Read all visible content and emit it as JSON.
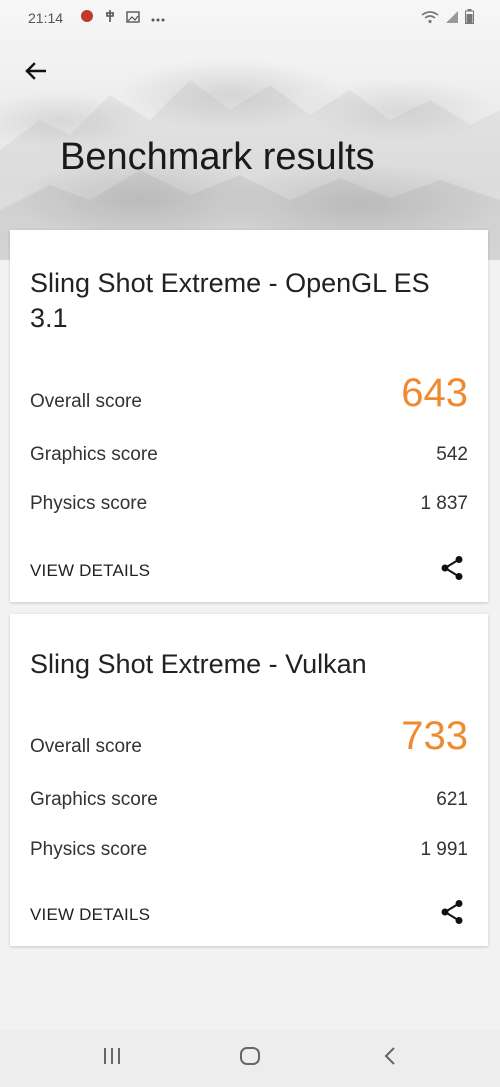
{
  "status_bar": {
    "time": "21:14",
    "left_icons": [
      "notification-dot-icon",
      "usb-icon",
      "image-icon",
      "more-icon"
    ],
    "right_icons": [
      "wifi-icon",
      "signal-icon",
      "battery-icon"
    ]
  },
  "header": {
    "title": "Benchmark results",
    "back_icon": "back-arrow-icon"
  },
  "results": [
    {
      "title": "Sling Shot Extreme - OpenGL ES 3.1",
      "overall_label": "Overall score",
      "overall_value": "643",
      "graphics_label": "Graphics score",
      "graphics_value": "542",
      "physics_label": "Physics score",
      "physics_value": "1 837",
      "details_label": "VIEW DETAILS",
      "share_icon": "share-icon"
    },
    {
      "title": "Sling Shot Extreme - Vulkan",
      "overall_label": "Overall score",
      "overall_value": "733",
      "graphics_label": "Graphics score",
      "graphics_value": "621",
      "physics_label": "Physics score",
      "physics_value": "1 991",
      "details_label": "VIEW DETAILS",
      "share_icon": "share-icon"
    }
  ],
  "nav_bar": {
    "items": [
      "recent-apps-icon",
      "home-icon",
      "back-icon"
    ]
  },
  "colors": {
    "accent": "#f08a2e",
    "card_background": "#ffffff",
    "page_background": "#f2f2f2"
  }
}
